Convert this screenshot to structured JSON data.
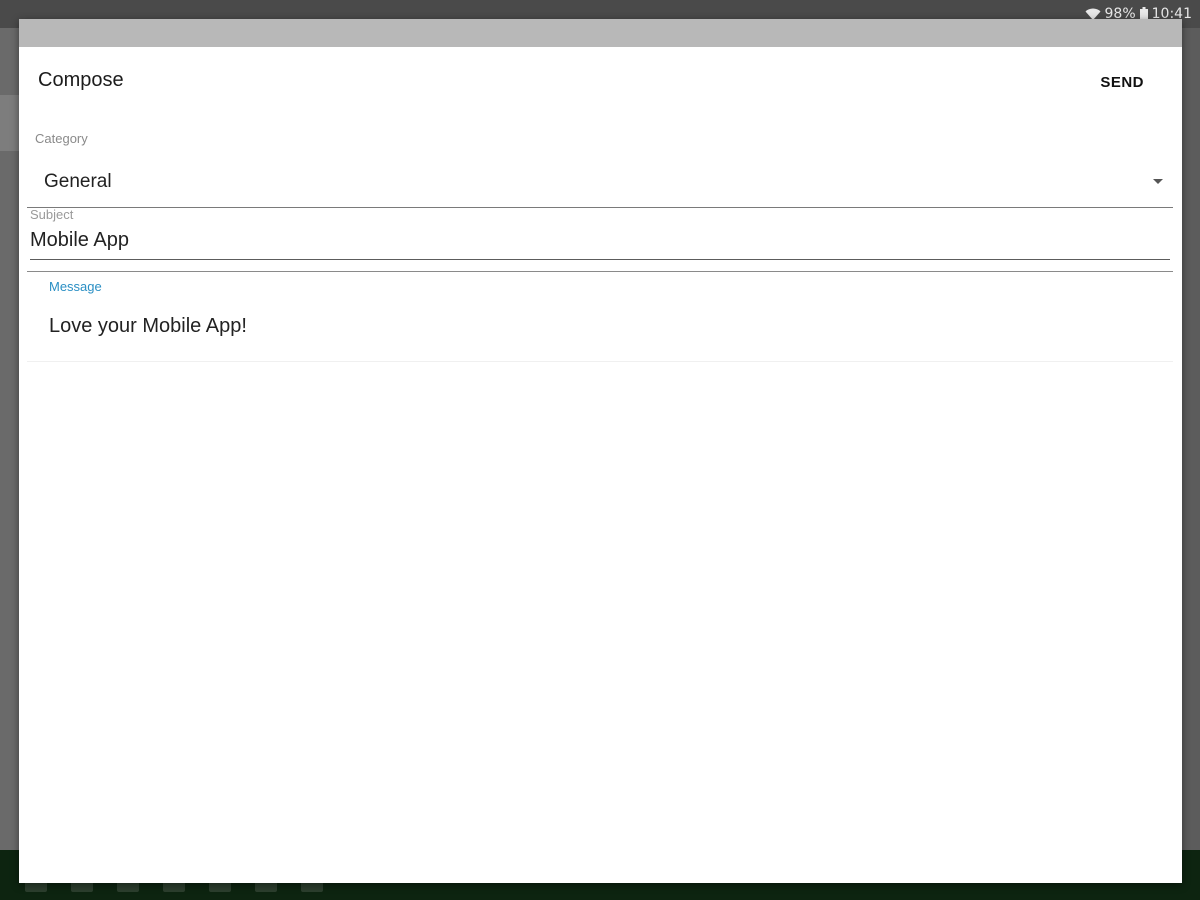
{
  "status_bar": {
    "battery_percent": "98%",
    "time": "10:41",
    "wifi_icon": "wifi-icon",
    "battery_icon": "battery-icon"
  },
  "dialog": {
    "title": "Compose",
    "send_label": "SEND"
  },
  "form": {
    "category": {
      "label": "Category",
      "value": "General"
    },
    "subject": {
      "label": "Subject",
      "value": "Mobile App"
    },
    "message": {
      "label": "Message",
      "value": "Love your Mobile App!"
    }
  },
  "colors": {
    "accent": "#2a8fc4",
    "dialog_topbar": "#b8b8b8",
    "status_bar": "#4a4a4a"
  }
}
